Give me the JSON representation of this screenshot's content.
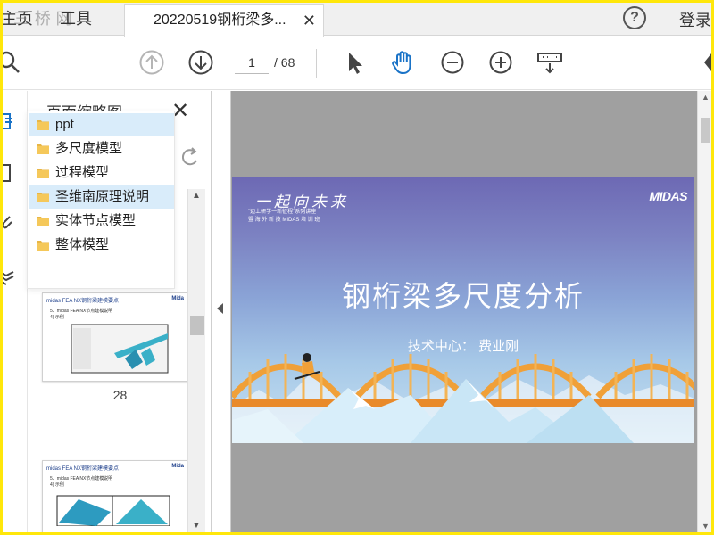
{
  "tabs": {
    "home_label": "主页",
    "home_watermark": "三 桥 网",
    "tools_label": "工具",
    "doc_title": "20220519钢桁梁多...",
    "close_glyph": "✕"
  },
  "header": {
    "help_glyph": "?",
    "login_label": "登录"
  },
  "toolbar": {
    "current_page": "1",
    "total_pages": "/ 68"
  },
  "thumbnail_panel": {
    "title": "页面缩略图",
    "close_glyph": "✕",
    "thumbnails": [
      {
        "header": "midas FEA NX钢桁梁建模要点",
        "logo": "Mida",
        "line1": "5、midas FEA NX节点建模说明",
        "line2": "4) 示例",
        "page_number": "28"
      },
      {
        "header": "midas FEA NX钢桁梁建模要点",
        "logo": "Mida",
        "line1": "5、midas FEA NX节点建模说明",
        "line2": "4) 示例"
      }
    ]
  },
  "folder_dropdown": {
    "items": [
      {
        "label": "ppt",
        "selected": true
      },
      {
        "label": "多尺度模型",
        "selected": false
      },
      {
        "label": "过程模型",
        "selected": false
      },
      {
        "label": "圣维南原理说明",
        "selected": true
      },
      {
        "label": "实体节点模型",
        "selected": false
      },
      {
        "label": "整体模型",
        "selected": false
      }
    ]
  },
  "slide": {
    "brand": "一起向未来",
    "brand_sub_1": "\"迈上研学一新征程\"系列讲座",
    "brand_sub_2": "暨 海 外 新 技 MIDAS 培 训 班",
    "logo": "MIDAS",
    "title": "钢桁梁多尺度分析",
    "subtitle": "技术中心：  费业刚"
  },
  "colors": {
    "frame": "#ffe70a",
    "accent_blue": "#1a73c7",
    "selection": "#d9ecfa",
    "doc_background": "#a0a0a0"
  }
}
